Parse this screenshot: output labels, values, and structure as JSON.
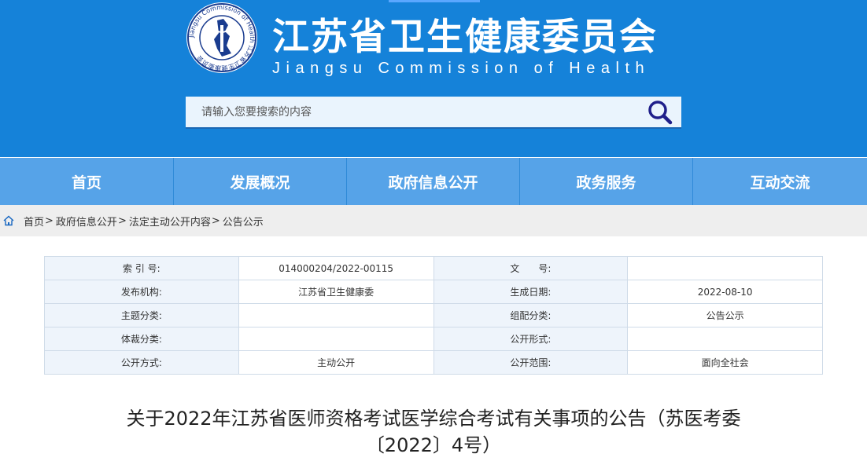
{
  "header": {
    "title_cn": "江苏省卫生健康委员会",
    "title_en": "Jiangsu Commission of Health",
    "logo_text": "Jiangsu Commission of Health 江苏省卫生健康委员会",
    "brand_color": "#1582d9"
  },
  "search": {
    "placeholder": "请输入您要搜索的内容",
    "icon": "search-icon"
  },
  "nav": {
    "items": [
      {
        "label": "首页"
      },
      {
        "label": "发展概况"
      },
      {
        "label": "政府信息公开"
      },
      {
        "label": "政务服务"
      },
      {
        "label": "互动交流"
      }
    ]
  },
  "breadcrumb": {
    "icon": "home-icon",
    "items": [
      "首页",
      "政府信息公开",
      "法定主动公开内容",
      "公告公示"
    ],
    "separator": ">"
  },
  "meta": {
    "rows": [
      {
        "l1": "索 引 号:",
        "v1": "014000204/2022-00115",
        "l2": "文　　号:",
        "v2": ""
      },
      {
        "l1": "发布机构:",
        "v1": "江苏省卫生健康委",
        "l2": "生成日期:",
        "v2": "2022-08-10"
      },
      {
        "l1": "主题分类:",
        "v1": "",
        "l2": "组配分类:",
        "v2": "公告公示"
      },
      {
        "l1": "体裁分类:",
        "v1": "",
        "l2": "公开形式:",
        "v2": ""
      },
      {
        "l1": "公开方式:",
        "v1": "主动公开",
        "l2": "公开范围:",
        "v2": "面向全社会"
      }
    ]
  },
  "article": {
    "title_line1": "关于2022年江苏省医师资格考试医学综合考试有关事项的公告（苏医考委",
    "title_line2": "〔2022〕4号）"
  }
}
